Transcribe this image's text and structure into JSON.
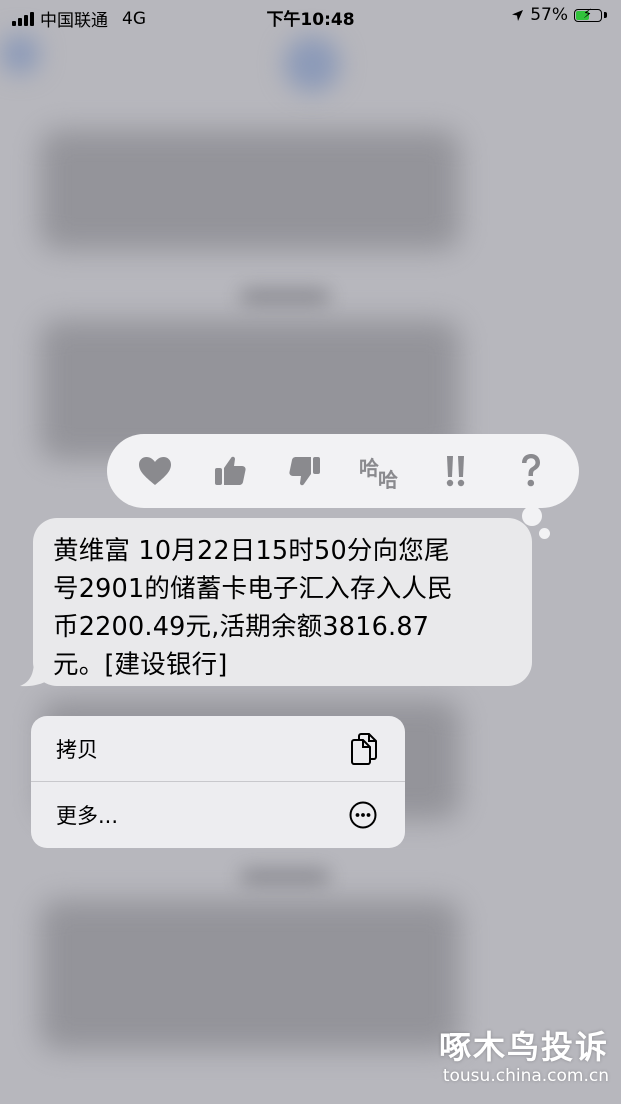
{
  "status_bar": {
    "carrier": "中国联通",
    "network": "4G",
    "time": "下午10:48",
    "battery_percent": "57%",
    "battery_level": 0.57,
    "battery_color": "#31c23c"
  },
  "reactions": [
    {
      "icon": "heart-icon",
      "label": "heart"
    },
    {
      "icon": "thumbs-up-icon",
      "label": "like"
    },
    {
      "icon": "thumbs-down-icon",
      "label": "dislike"
    },
    {
      "icon": "haha-icon",
      "label": "haha"
    },
    {
      "icon": "exclamation-icon",
      "label": "emphasize"
    },
    {
      "icon": "question-icon",
      "label": "question"
    }
  ],
  "message": {
    "lines": [
      "黄维富 10月22日15时50分向您尾",
      "号2901的储蓄卡电子汇入存入人民",
      "币2200.49元,活期余额3816.87",
      "元。[建设银行]"
    ]
  },
  "context_menu": {
    "copy_label": "拷贝",
    "more_label": "更多...",
    "copy_icon": "copy-icon",
    "more_icon": "ellipsis-circle-icon"
  },
  "watermark": {
    "title": "啄木鸟投诉",
    "url": "tousu.china.com.cn"
  }
}
